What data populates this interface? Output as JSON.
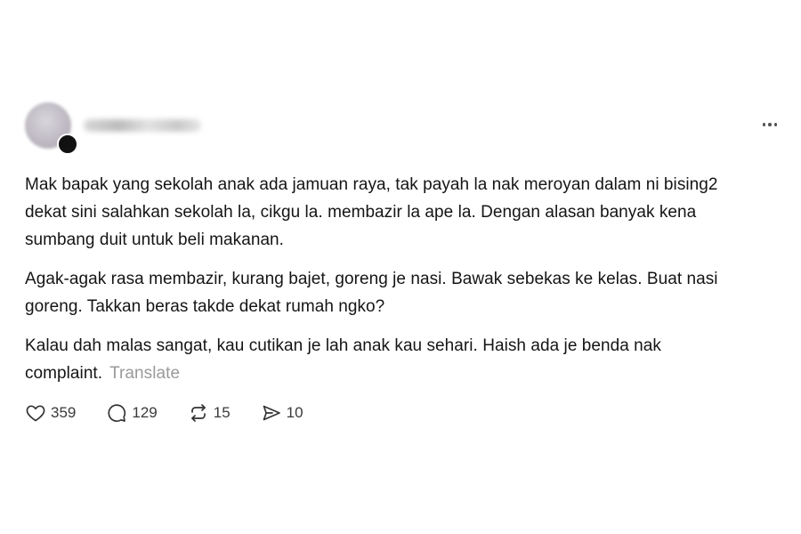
{
  "post": {
    "paragraphs": [
      "Mak bapak yang sekolah anak ada jamuan raya, tak payah la nak meroyan dalam ni bising2 dekat sini salahkan sekolah la, cikgu la. membazir la ape la. Dengan alasan banyak kena sumbang duit untuk beli makanan.",
      "Agak-agak rasa membazir, kurang bajet, goreng je nasi. Bawak sebekas ke kelas. Buat nasi goreng. Takkan beras takde dekat rumah ngko?",
      "Kalau dah malas sangat, kau cutikan je lah anak kau sehari. Haish ada je benda nak complaint."
    ],
    "translate_label": "Translate"
  },
  "actions": {
    "likes": "359",
    "replies": "129",
    "reposts": "15",
    "shares": "10"
  },
  "icons": {
    "more": "more-horizontal-icon",
    "like": "heart-icon",
    "reply": "comment-icon",
    "repost": "repost-icon",
    "share": "share-icon"
  }
}
